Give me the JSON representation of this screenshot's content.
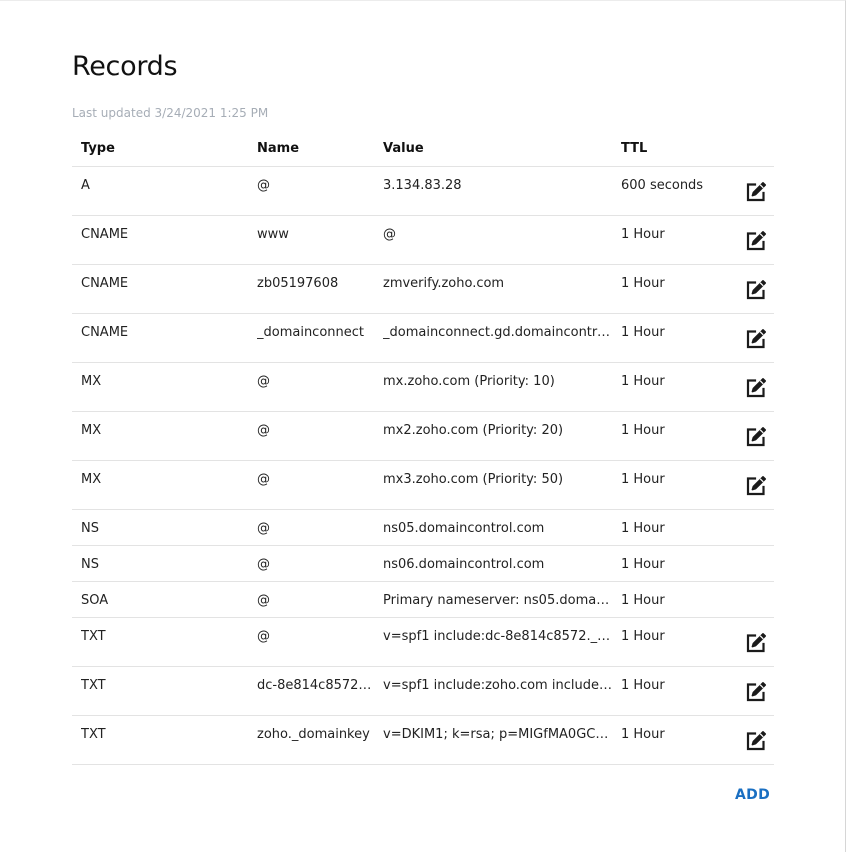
{
  "section": {
    "title": "Records",
    "last_updated": "Last updated 3/24/2021 1:25 PM",
    "add_label": "ADD"
  },
  "table": {
    "columns": [
      "Type",
      "Name",
      "Value",
      "TTL"
    ],
    "rows": [
      {
        "type": "A",
        "name": "@",
        "value": "3.134.83.28",
        "ttl": "600 seconds",
        "editable": true
      },
      {
        "type": "CNAME",
        "name": "www",
        "value": "@",
        "ttl": "1 Hour",
        "editable": true
      },
      {
        "type": "CNAME",
        "name": "zb05197608",
        "value": "zmverify.zoho.com",
        "ttl": "1 Hour",
        "editable": true
      },
      {
        "type": "CNAME",
        "name": "_domainconnect",
        "value": "_domainconnect.gd.domaincontrol....",
        "ttl": "1 Hour",
        "editable": true
      },
      {
        "type": "MX",
        "name": "@",
        "value": "mx.zoho.com (Priority: 10)",
        "ttl": "1 Hour",
        "editable": true
      },
      {
        "type": "MX",
        "name": "@",
        "value": "mx2.zoho.com (Priority: 20)",
        "ttl": "1 Hour",
        "editable": true
      },
      {
        "type": "MX",
        "name": "@",
        "value": "mx3.zoho.com (Priority: 50)",
        "ttl": "1 Hour",
        "editable": true
      },
      {
        "type": "NS",
        "name": "@",
        "value": "ns05.domaincontrol.com",
        "ttl": "1 Hour",
        "editable": false
      },
      {
        "type": "NS",
        "name": "@",
        "value": "ns06.domaincontrol.com",
        "ttl": "1 Hour",
        "editable": false
      },
      {
        "type": "SOA",
        "name": "@",
        "value": "Primary nameserver: ns05.domainc...",
        "ttl": "1 Hour",
        "editable": false
      },
      {
        "type": "TXT",
        "name": "@",
        "value": "v=spf1 include:dc-8e814c8572._spf...",
        "ttl": "1 Hour",
        "editable": true
      },
      {
        "type": "TXT",
        "name": "dc-8e814c8572....",
        "value": "v=spf1 include:zoho.com include:zo...",
        "ttl": "1 Hour",
        "editable": true
      },
      {
        "type": "TXT",
        "name": "zoho._domainkey",
        "value": "v=DKIM1; k=rsa; p=MIGfMA0GCSq...",
        "ttl": "1 Hour",
        "editable": true
      }
    ],
    "edit_icon": "edit-icon"
  },
  "colors": {
    "accent": "#1a6fc2",
    "muted_text": "#a6adb6",
    "divider": "#e3e3e3"
  }
}
